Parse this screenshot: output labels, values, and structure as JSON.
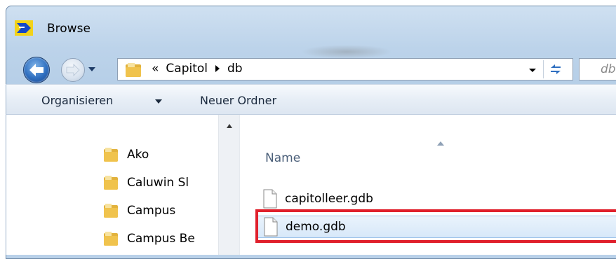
{
  "window": {
    "title": "Browse"
  },
  "address": {
    "overflow": "«",
    "crumbs": [
      "Capitol",
      "db"
    ]
  },
  "search": {
    "placeholder": "db"
  },
  "toolbar": {
    "organize_label": "Organisieren",
    "new_folder_label": "Neuer Ordner"
  },
  "navpane": {
    "items": [
      "Ako",
      "Caluwin Sl",
      "Campus",
      "Campus Be"
    ]
  },
  "filelist": {
    "column_header": "Name",
    "files": [
      {
        "name": "capitolleer.gdb",
        "selected": false
      },
      {
        "name": "demo.gdb",
        "selected": true
      }
    ]
  },
  "colors": {
    "highlight": "#e0202c",
    "selection": "#d7e8f9"
  }
}
